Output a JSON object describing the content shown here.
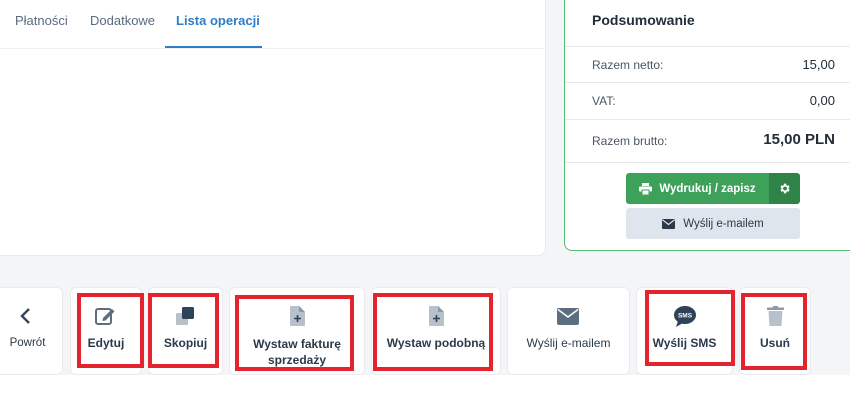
{
  "tabs": [
    "Płatności",
    "Dodatkowe",
    "Lista operacji"
  ],
  "summary": {
    "title": "Podsumowanie",
    "rows": [
      {
        "label": "Razem netto:",
        "value": "15,00"
      },
      {
        "label": "VAT:",
        "value": "0,00"
      },
      {
        "label": "Razem brutto:",
        "value": "15,00 PLN"
      }
    ],
    "print_label": "Wydrukuj / zapisz",
    "email_label": "Wyślij e-mailem"
  },
  "actions": [
    {
      "label": "Powrót"
    },
    {
      "label": "Edytuj"
    },
    {
      "label": "Skopiuj"
    },
    {
      "label": "Wystaw fakturę sprzedaży"
    },
    {
      "label": "Wystaw podobną"
    },
    {
      "label": "Wyślij e-mailem"
    },
    {
      "label": "Wyślij SMS",
      "icon_text": "SMS"
    },
    {
      "label": "Usuń"
    }
  ],
  "colors": {
    "accent": "#2e7ec6",
    "green": "#3da15a",
    "highlight": "#e3232d",
    "icon": "#5d6e7f"
  }
}
